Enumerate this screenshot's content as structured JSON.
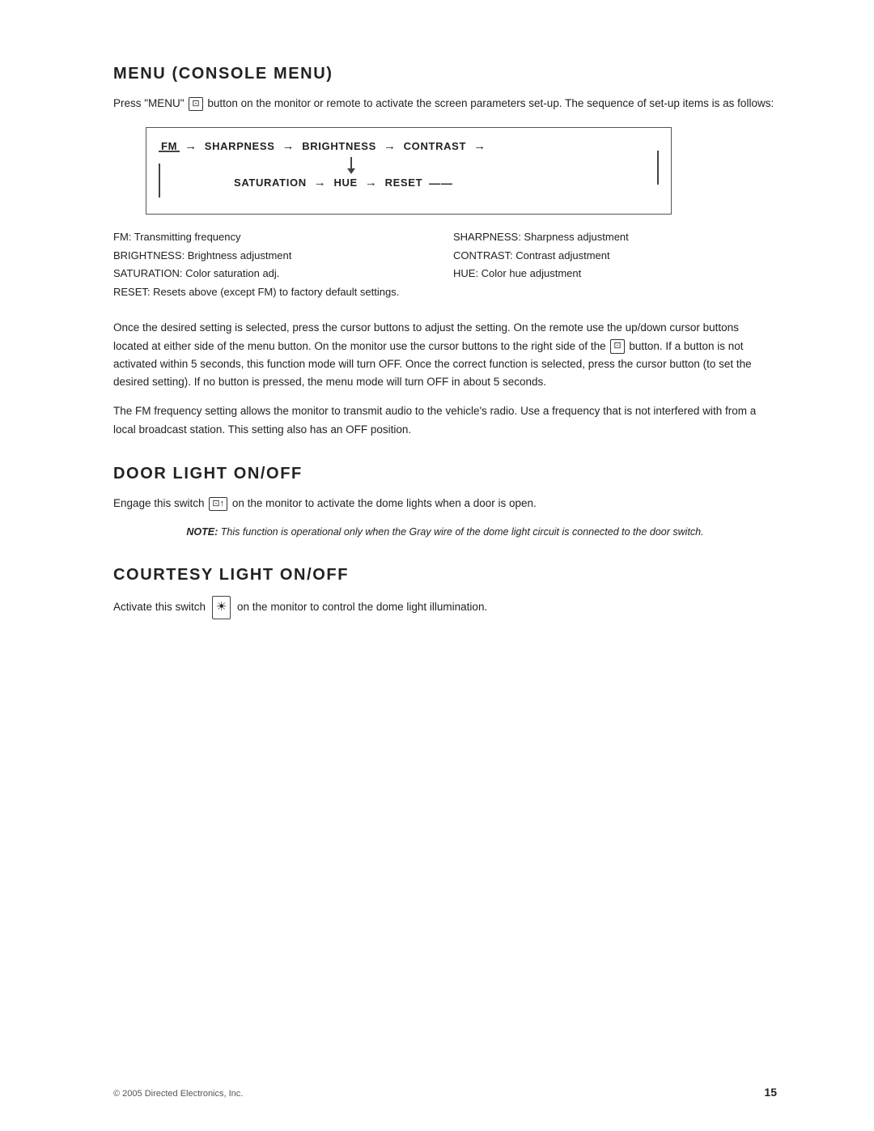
{
  "sections": {
    "menu": {
      "title": "Menu (Console Menu)",
      "intro": "Press \"MENU\"",
      "intro_rest": " button on the monitor or remote to activate the screen parameters set-up. The sequence of set-up items is as follows:",
      "diagram": {
        "top_row": [
          "FM",
          "→",
          "SHARPNESS",
          "→",
          "BRIGHTNESS",
          "→",
          "CONTRAST",
          "→"
        ],
        "bottom_row": [
          "SATURATION",
          "→",
          "HUE",
          "→",
          "RESET",
          "—"
        ]
      },
      "legend": [
        {
          "left": "FM: Transmitting frequency",
          "right": "SHARPNESS: Sharpness adjustment"
        },
        {
          "left": "BRIGHTNESS: Brightness adjustment",
          "right": "CONTRAST: Contrast adjustment"
        },
        {
          "left": "SATURATION: Color saturation adj.",
          "right": "HUE: Color hue adjustment"
        },
        {
          "left": "RESET: Resets above (except FM) to factory default settings.",
          "right": ""
        }
      ],
      "para1": "Once the desired setting is selected, press the cursor buttons to adjust the setting. On the remote use the up/down cursor buttons located at either side of the menu button. On the monitor use the cursor buttons to the right side of the",
      "para1_mid": " button. If a button is not activated within 5 seconds, this function mode will turn OFF. Once the correct function is selected, press the cursor button (to set the desired setting). If no button is pressed, the menu mode will turn OFF in about 5 seconds.",
      "para2": "The FM frequency setting allows the monitor to transmit audio to the vehicle's radio. Use a frequency that is not interfered with from a local broadcast station. This setting also has an OFF position."
    },
    "door_light": {
      "title": "Door Light On/Off",
      "text_before": "Engage this switch",
      "text_after": " on the monitor to activate the dome lights when a door is open.",
      "note": "NOTE: This function is operational only when the Gray wire of the dome light circuit is connected to the door switch."
    },
    "courtesy_light": {
      "title": "Courtesy Light On/Off",
      "text_before": "Activate this switch",
      "text_after": " on the monitor to control the dome light illumination."
    }
  },
  "footer": {
    "copyright": "© 2005 Directed Electronics, Inc.",
    "page_number": "15"
  }
}
